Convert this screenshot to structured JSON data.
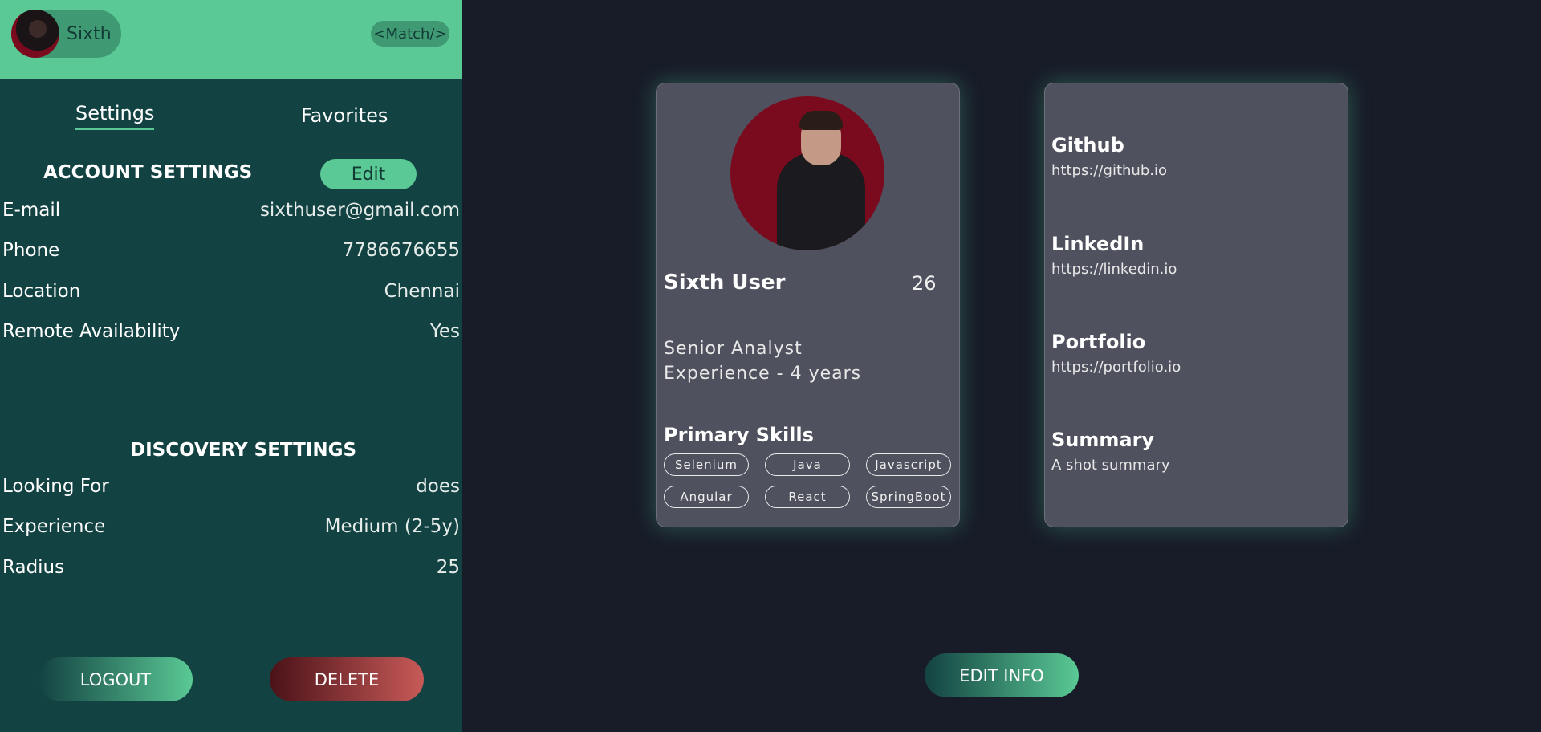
{
  "header": {
    "user_name": "Sixth",
    "logo_text": "<Match/>"
  },
  "tabs": {
    "settings": "Settings",
    "favorites": "Favorites"
  },
  "account": {
    "title": "ACCOUNT SETTINGS",
    "edit_label": "Edit",
    "rows": [
      {
        "label": "E-mail",
        "value": "sixthuser@gmail.com"
      },
      {
        "label": "Phone",
        "value": "7786676655"
      },
      {
        "label": "Location",
        "value": "Chennai"
      },
      {
        "label": "Remote Availability",
        "value": "Yes"
      }
    ]
  },
  "discovery": {
    "title": "DISCOVERY SETTINGS",
    "rows": [
      {
        "label": "Looking For",
        "value": "does"
      },
      {
        "label": "Experience",
        "value": "Medium (2-5y)"
      },
      {
        "label": "Radius",
        "value": "25"
      }
    ]
  },
  "actions": {
    "logout": "LOGOUT",
    "delete": "DELETE",
    "edit_info": "EDIT INFO"
  },
  "profile": {
    "name": "Sixth User",
    "age": "26",
    "role": "Senior Analyst",
    "experience": "Experience - 4 years",
    "skills_title": "Primary Skills",
    "skills": [
      "Selenium",
      "Java",
      "Javascript",
      "Angular",
      "React",
      "SpringBoot"
    ]
  },
  "links": {
    "github_title": "Github",
    "github_url": "https://github.io",
    "linkedin_title": "LinkedIn",
    "linkedin_url": "https://linkedin.io",
    "portfolio_title": "Portfolio",
    "portfolio_url": "https://portfolio.io",
    "summary_title": "Summary",
    "summary_text": "A shot summary"
  },
  "colors": {
    "accent": "#5ac995",
    "sidebar": "#134242",
    "page_bg": "#171c28",
    "card_bg": "#4f525e",
    "delete": "#c85a58"
  }
}
